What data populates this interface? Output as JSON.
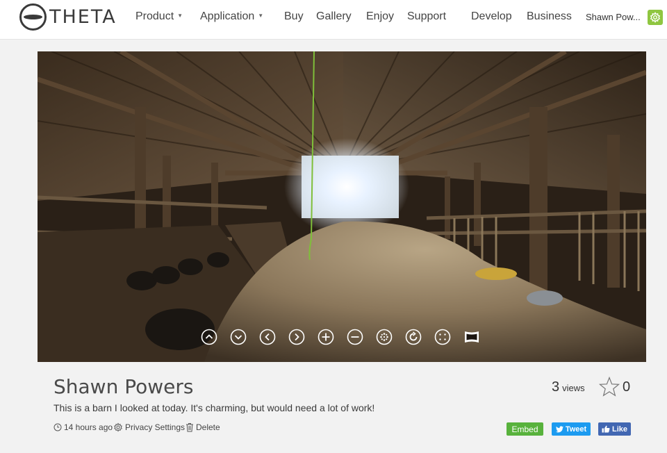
{
  "header": {
    "logo_text": "THETA",
    "nav": [
      {
        "label": "Product",
        "dropdown": true
      },
      {
        "label": "Application",
        "dropdown": true
      },
      {
        "label": "Buy",
        "dropdown": false
      },
      {
        "label": "Gallery",
        "dropdown": false
      },
      {
        "label": "Enjoy",
        "dropdown": false
      },
      {
        "label": "Support",
        "dropdown": false
      },
      {
        "label": "Develop",
        "dropdown": false
      },
      {
        "label": "Business",
        "dropdown": false
      }
    ],
    "user_name": "Shawn Pow...",
    "settings_icon": "gear-icon",
    "accent_color": "#8fc640"
  },
  "viewer": {
    "controls": [
      {
        "name": "rotate-up",
        "icon": "chevron-up-icon"
      },
      {
        "name": "rotate-down",
        "icon": "chevron-down-icon"
      },
      {
        "name": "rotate-left",
        "icon": "chevron-left-icon"
      },
      {
        "name": "rotate-right",
        "icon": "chevron-right-icon"
      },
      {
        "name": "zoom-in",
        "icon": "plus-icon"
      },
      {
        "name": "zoom-out",
        "icon": "minus-icon"
      },
      {
        "name": "view-mode",
        "icon": "sphere-icon"
      },
      {
        "name": "auto-rotate",
        "icon": "refresh-icon"
      },
      {
        "name": "fullscreen",
        "icon": "fullscreen-icon"
      },
      {
        "name": "panorama",
        "icon": "panorama-icon"
      }
    ]
  },
  "post": {
    "title": "Shawn Powers",
    "description": "This is a barn I looked at today. It's charming, but would need a lot of work!",
    "time_ago": "14 hours ago",
    "privacy_label": "Privacy Settings",
    "delete_label": "Delete",
    "views_count": "3",
    "views_label": "views",
    "star_count": "0"
  },
  "share": {
    "embed_label": "Embed",
    "tweet_label": "Tweet",
    "like_label": "Like",
    "embed_color": "#58b23c",
    "tweet_color": "#1d9bf0",
    "like_color": "#4267b2"
  }
}
